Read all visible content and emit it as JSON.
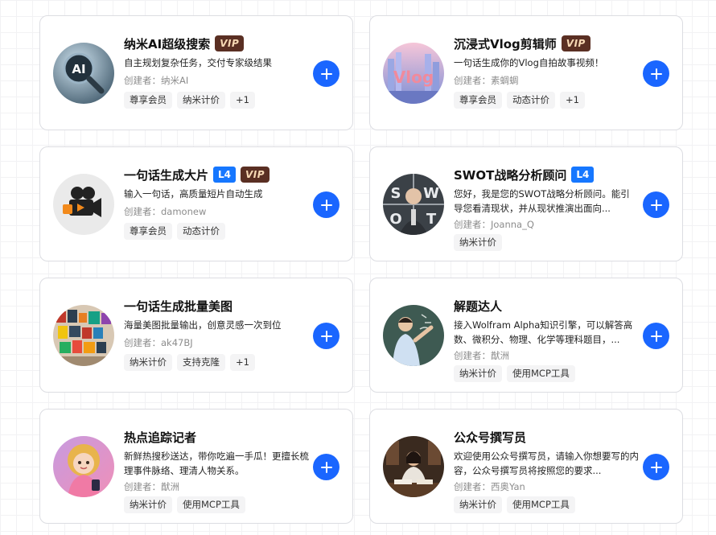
{
  "accent_color": "#1a66ff",
  "cards": [
    {
      "title": "纳米AI超级搜索",
      "badges": [
        "vip"
      ],
      "vip_label": "VIP",
      "description": "自主规划复杂任务，交付专家级结果",
      "creator": "创建者：纳米AI",
      "tags": [
        "尊享会员",
        "纳米计价",
        "+1"
      ],
      "avatar_icon": "ai-magnifier-icon"
    },
    {
      "title": "沉浸式Vlog剪辑师",
      "badges": [
        "vip"
      ],
      "vip_label": "VIP",
      "description": "一句话生成你的Vlog自拍故事视频！",
      "creator": "创建者：素蜩蜩",
      "tags": [
        "尊享会员",
        "动态计价",
        "+1"
      ],
      "avatar_icon": "vlog-city-icon"
    },
    {
      "title": "一句话生成大片",
      "badges": [
        "level",
        "vip"
      ],
      "level_label": "L4",
      "vip_label": "VIP",
      "description": "输入一句话，高质量短片自动生成",
      "creator": "创建者：damonew",
      "tags": [
        "尊享会员",
        "动态计价"
      ],
      "avatar_icon": "movie-camera-icon"
    },
    {
      "title": "SWOT战略分析顾问",
      "badges": [
        "level"
      ],
      "level_label": "L4",
      "description": "您好，我是您的SWOT战略分析顾问。能引导您看清现状，并从现状推演出面向...",
      "creator": "创建者：Joanna_Q",
      "tags": [
        "纳米计价"
      ],
      "avatar_icon": "swot-advisor-icon"
    },
    {
      "title": "一句话生成批量美图",
      "badges": [],
      "description": "海量美图批量输出，创意灵感一次到位",
      "creator": "创建者：ak47BJ",
      "tags": [
        "纳米计价",
        "支持克隆",
        "+1"
      ],
      "avatar_icon": "photo-wall-icon"
    },
    {
      "title": "解题达人",
      "badges": [],
      "description": "接入Wolfram Alpha知识引擎，可以解答高数、微积分、物理、化学等理科题目，...",
      "creator": "创建者：猷洲",
      "tags": [
        "纳米计价",
        "使用MCP工具"
      ],
      "avatar_icon": "teacher-blackboard-icon"
    },
    {
      "title": "热点追踪记者",
      "badges": [],
      "description": "新鲜热搜秒送达，带你吃遍一手瓜！更擅长梳理事件脉络、理清人物关系。",
      "creator": "创建者：猷洲",
      "tags": [
        "纳米计价",
        "使用MCP工具"
      ],
      "avatar_icon": "reporter-girl-icon"
    },
    {
      "title": "公众号撰写员",
      "badges": [],
      "description": "欢迎使用公众号撰写员，请输入你想要写的内容，公众号撰写员将按照您的要求...",
      "creator": "创建者：西奥Yan",
      "tags": [
        "纳米计价",
        "使用MCP工具"
      ],
      "avatar_icon": "writer-desk-icon"
    }
  ]
}
